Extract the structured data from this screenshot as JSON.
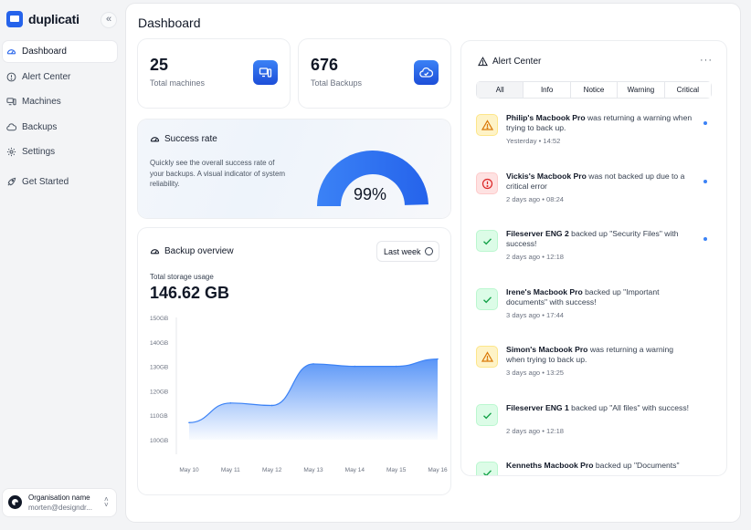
{
  "app": {
    "name": "duplicati",
    "collapse_icon": "«"
  },
  "sidebar": {
    "items": [
      {
        "label": "Dashboard",
        "icon": "gauge-icon",
        "active": true
      },
      {
        "label": "Alert Center",
        "icon": "alert-circle-icon"
      },
      {
        "label": "Machines",
        "icon": "machines-icon"
      },
      {
        "label": "Backups",
        "icon": "cloud-icon"
      },
      {
        "label": "Settings",
        "icon": "gear-icon"
      },
      {
        "label": "Get Started",
        "icon": "rocket-icon"
      }
    ],
    "org": {
      "name": "Organisation name",
      "email": "morten@designdr..."
    }
  },
  "dashboard": {
    "title": "Dashboard",
    "stats": [
      {
        "value": "25",
        "label": "Total machines",
        "icon": "machines-icon"
      },
      {
        "value": "676",
        "label": "Total Backups",
        "icon": "cloud-check-icon"
      }
    ],
    "success": {
      "title": "Success rate",
      "description": "Quickly see the overall success rate of your backups. A visual indicator of system reliability.",
      "value": "99%",
      "percent": 99
    },
    "backup": {
      "title": "Backup overview",
      "period": "Last week",
      "storage_label": "Total storage usage",
      "storage_value": "146.62 GB"
    }
  },
  "chart_data": {
    "type": "area",
    "title": "Backup overview",
    "x": [
      "May 10",
      "May 11",
      "May 12",
      "May 13",
      "May 14",
      "May 15",
      "May 16"
    ],
    "series": [
      {
        "values": [
          107,
          115,
          114,
          131,
          130,
          130,
          133
        ]
      }
    ],
    "yticks": [
      "150GB",
      "140GB",
      "130GB",
      "120GB",
      "110GB",
      "100GB"
    ],
    "ylim": [
      100,
      150
    ],
    "color": "#3b82f6",
    "grid": false
  },
  "alerts": {
    "title": "Alert Center",
    "more_icon": "···",
    "tabs": [
      "All",
      "Info",
      "Notice",
      "Warning",
      "Critical"
    ],
    "active_tab": "All",
    "items": [
      {
        "type": "warning",
        "name": "Philip's Macbook Pro",
        "message": " was returning a warning when trying to back up.",
        "date": "Yesterday",
        "time": "14:52",
        "unread": true
      },
      {
        "type": "error",
        "name": "Vickis's Macbook Pro",
        "message": " was not backed up due to a critical error",
        "date": "2 days ago",
        "time": "08:24",
        "unread": true
      },
      {
        "type": "success",
        "name": "Fileserver ENG 2",
        "message": " backed up \"Security Files\" with success!",
        "date": "2 days ago",
        "time": "12:18",
        "unread": true
      },
      {
        "type": "success",
        "name": "Irene's Macbook Pro",
        "message": " backed up \"Important documents\" with success!",
        "date": "3 days ago",
        "time": "17:44",
        "unread": false
      },
      {
        "type": "warning",
        "name": "Simon's Macbook Pro",
        "message": " was returning a warning when trying to back up.",
        "date": "3 days ago",
        "time": "13:25",
        "unread": false
      },
      {
        "type": "success",
        "name": "Fileserver ENG 1",
        "message": " backed up \"All files\" with success!",
        "date": "2 days ago",
        "time": "12:18",
        "unread": false
      },
      {
        "type": "success",
        "name": "Kenneths Macbook Pro",
        "message": " backed up \"Documents\"",
        "date": "",
        "time": "",
        "unread": false
      }
    ]
  }
}
